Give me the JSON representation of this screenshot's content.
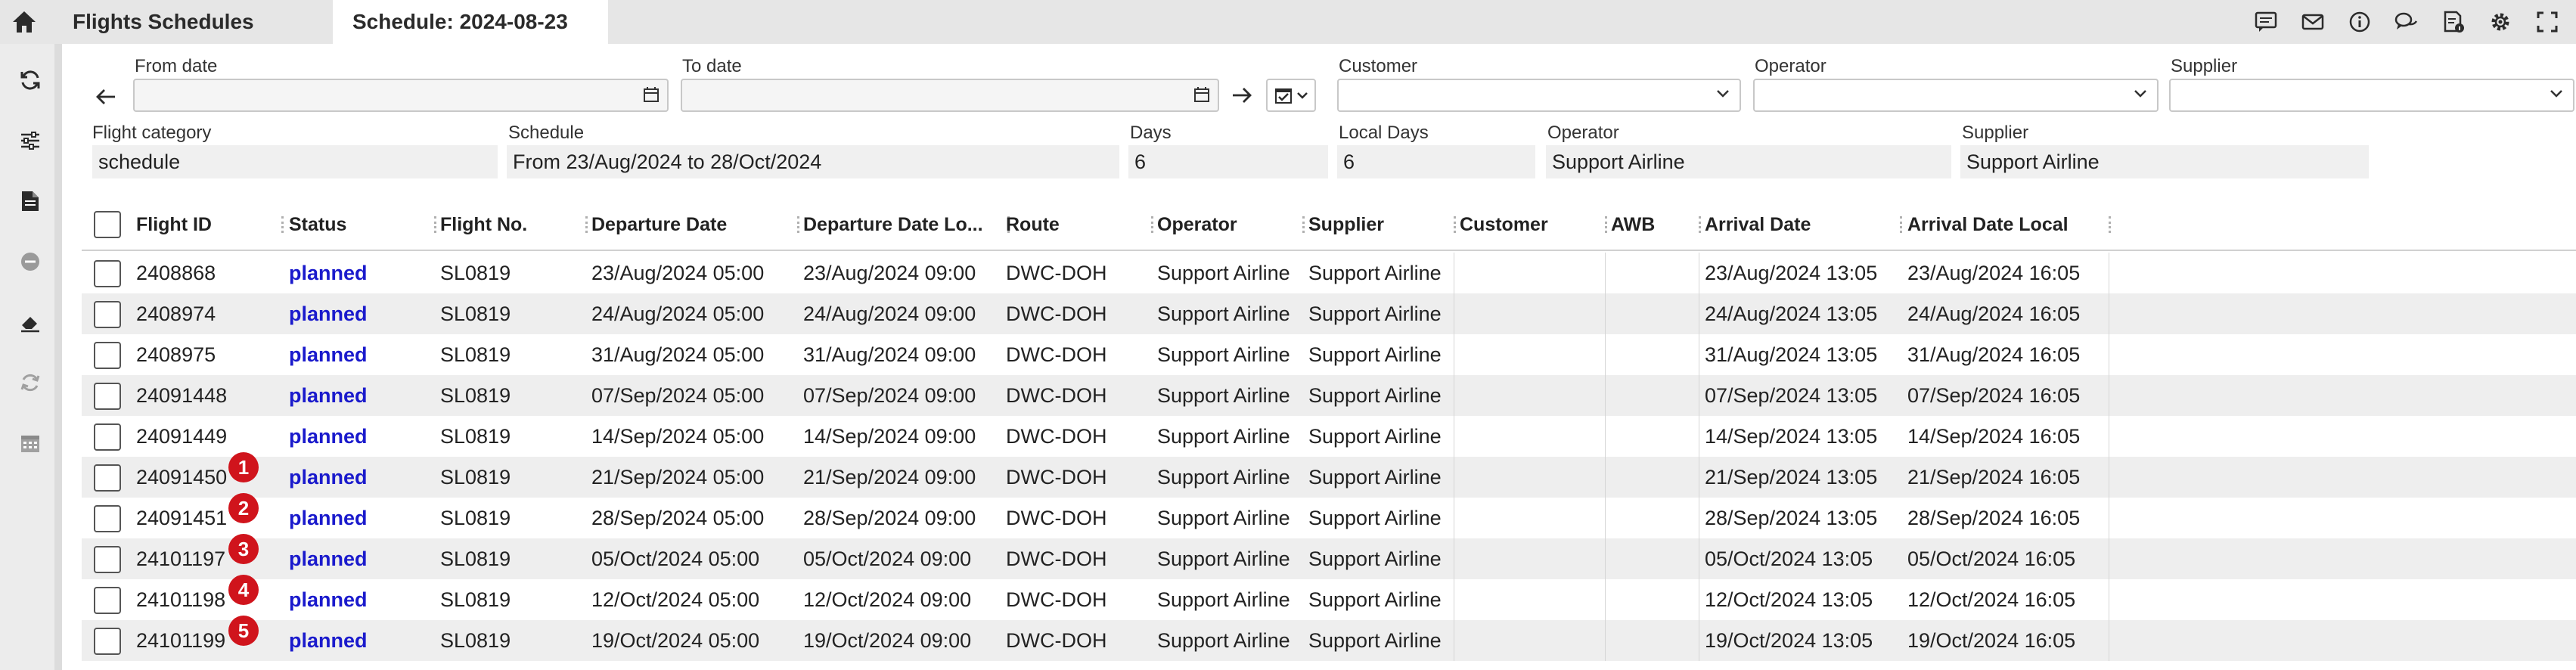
{
  "header": {
    "tabs": [
      {
        "label": "Flights Schedules"
      },
      {
        "label": "Schedule: 2024-08-23"
      }
    ],
    "right_icons": [
      "comment-icon",
      "mail-icon",
      "info-icon",
      "chat-icon",
      "document-info-icon",
      "gear-icon",
      "fullscreen-icon"
    ]
  },
  "sidebar": {
    "icons": [
      "refresh-icon",
      "sliders-icon",
      "document-icon",
      "minus-circle-icon",
      "eraser-icon",
      "sync-disabled-icon",
      "calendar-icon"
    ]
  },
  "filters": {
    "from_date": {
      "label": "From date",
      "value": ""
    },
    "to_date": {
      "label": "To date",
      "value": ""
    },
    "customer": {
      "label": "Customer",
      "value": ""
    },
    "operator": {
      "label": "Operator",
      "value": ""
    },
    "supplier": {
      "label": "Supplier",
      "value": ""
    }
  },
  "info": {
    "flight_category": {
      "label": "Flight category",
      "value": "schedule"
    },
    "schedule": {
      "label": "Schedule",
      "value": "From 23/Aug/2024 to 28/Oct/2024"
    },
    "days": {
      "label": "Days",
      "value": "6"
    },
    "local_days": {
      "label": "Local Days",
      "value": "6"
    },
    "operator": {
      "label": "Operator",
      "value": "Support Airline"
    },
    "supplier": {
      "label": "Supplier",
      "value": "Support Airline"
    }
  },
  "table": {
    "columns": [
      "Flight ID",
      "Status",
      "Flight No.",
      "Departure Date",
      "Departure Date Lo...",
      "Route",
      "Operator",
      "Supplier",
      "Customer",
      "AWB",
      "Arrival Date",
      "Arrival Date Local"
    ],
    "rows": [
      {
        "flight_id": "2408868",
        "status": "planned",
        "flight_no": "SL0819",
        "dep": "23/Aug/2024 05:00",
        "dep_local": "23/Aug/2024 09:00",
        "route": "DWC-DOH",
        "operator": "Support Airline",
        "supplier": "Support Airline",
        "customer": "",
        "awb": "",
        "arr": "23/Aug/2024 13:05",
        "arr_local": "23/Aug/2024 16:05",
        "badge": ""
      },
      {
        "flight_id": "2408974",
        "status": "planned",
        "flight_no": "SL0819",
        "dep": "24/Aug/2024 05:00",
        "dep_local": "24/Aug/2024 09:00",
        "route": "DWC-DOH",
        "operator": "Support Airline",
        "supplier": "Support Airline",
        "customer": "",
        "awb": "",
        "arr": "24/Aug/2024 13:05",
        "arr_local": "24/Aug/2024 16:05",
        "badge": ""
      },
      {
        "flight_id": "2408975",
        "status": "planned",
        "flight_no": "SL0819",
        "dep": "31/Aug/2024 05:00",
        "dep_local": "31/Aug/2024 09:00",
        "route": "DWC-DOH",
        "operator": "Support Airline",
        "supplier": "Support Airline",
        "customer": "",
        "awb": "",
        "arr": "31/Aug/2024 13:05",
        "arr_local": "31/Aug/2024 16:05",
        "badge": ""
      },
      {
        "flight_id": "24091448",
        "status": "planned",
        "flight_no": "SL0819",
        "dep": "07/Sep/2024 05:00",
        "dep_local": "07/Sep/2024 09:00",
        "route": "DWC-DOH",
        "operator": "Support Airline",
        "supplier": "Support Airline",
        "customer": "",
        "awb": "",
        "arr": "07/Sep/2024 13:05",
        "arr_local": "07/Sep/2024 16:05",
        "badge": ""
      },
      {
        "flight_id": "24091449",
        "status": "planned",
        "flight_no": "SL0819",
        "dep": "14/Sep/2024 05:00",
        "dep_local": "14/Sep/2024 09:00",
        "route": "DWC-DOH",
        "operator": "Support Airline",
        "supplier": "Support Airline",
        "customer": "",
        "awb": "",
        "arr": "14/Sep/2024 13:05",
        "arr_local": "14/Sep/2024 16:05",
        "badge": ""
      },
      {
        "flight_id": "24091450",
        "status": "planned",
        "flight_no": "SL0819",
        "dep": "21/Sep/2024 05:00",
        "dep_local": "21/Sep/2024 09:00",
        "route": "DWC-DOH",
        "operator": "Support Airline",
        "supplier": "Support Airline",
        "customer": "",
        "awb": "",
        "arr": "21/Sep/2024 13:05",
        "arr_local": "21/Sep/2024 16:05",
        "badge": "1"
      },
      {
        "flight_id": "24091451",
        "status": "planned",
        "flight_no": "SL0819",
        "dep": "28/Sep/2024 05:00",
        "dep_local": "28/Sep/2024 09:00",
        "route": "DWC-DOH",
        "operator": "Support Airline",
        "supplier": "Support Airline",
        "customer": "",
        "awb": "",
        "arr": "28/Sep/2024 13:05",
        "arr_local": "28/Sep/2024 16:05",
        "badge": "2"
      },
      {
        "flight_id": "24101197",
        "status": "planned",
        "flight_no": "SL0819",
        "dep": "05/Oct/2024 05:00",
        "dep_local": "05/Oct/2024 09:00",
        "route": "DWC-DOH",
        "operator": "Support Airline",
        "supplier": "Support Airline",
        "customer": "",
        "awb": "",
        "arr": "05/Oct/2024 13:05",
        "arr_local": "05/Oct/2024 16:05",
        "badge": "3"
      },
      {
        "flight_id": "24101198",
        "status": "planned",
        "flight_no": "SL0819",
        "dep": "12/Oct/2024 05:00",
        "dep_local": "12/Oct/2024 09:00",
        "route": "DWC-DOH",
        "operator": "Support Airline",
        "supplier": "Support Airline",
        "customer": "",
        "awb": "",
        "arr": "12/Oct/2024 13:05",
        "arr_local": "12/Oct/2024 16:05",
        "badge": "4"
      },
      {
        "flight_id": "24101199",
        "status": "planned",
        "flight_no": "SL0819",
        "dep": "19/Oct/2024 05:00",
        "dep_local": "19/Oct/2024 09:00",
        "route": "DWC-DOH",
        "operator": "Support Airline",
        "supplier": "Support Airline",
        "customer": "",
        "awb": "",
        "arr": "19/Oct/2024 13:05",
        "arr_local": "19/Oct/2024 16:05",
        "badge": "5"
      }
    ]
  }
}
